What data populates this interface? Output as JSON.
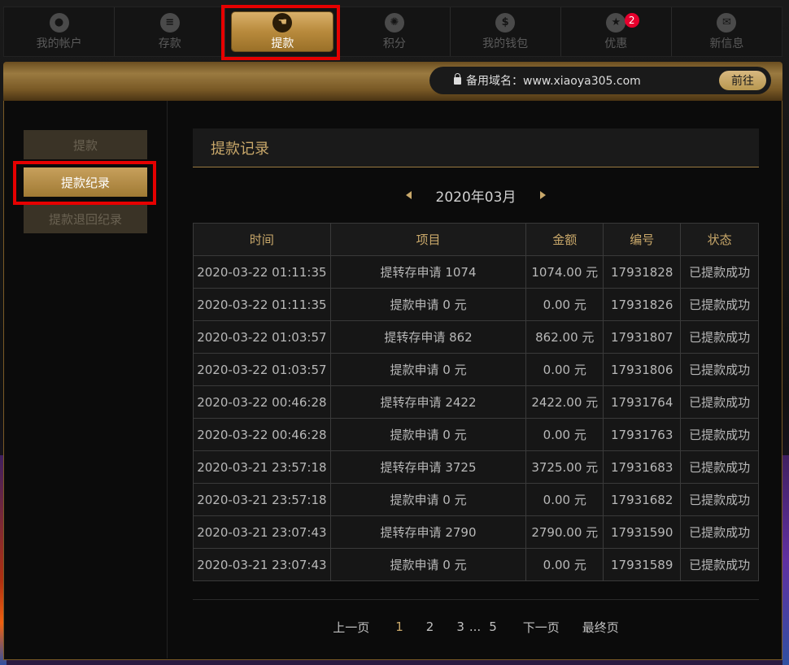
{
  "nav": {
    "items": [
      {
        "label": "我的帐户",
        "icon": "user-icon",
        "glyph": "●"
      },
      {
        "label": "存款",
        "icon": "coins-icon",
        "glyph": "≡"
      },
      {
        "label": "提款",
        "icon": "hand-withdraw-icon",
        "glyph": "☚"
      },
      {
        "label": "积分",
        "icon": "chip-icon",
        "glyph": "✺"
      },
      {
        "label": "我的钱包",
        "icon": "dollar-icon",
        "glyph": "$"
      },
      {
        "label": "优惠",
        "icon": "star-icon",
        "glyph": "★",
        "badge": "2"
      },
      {
        "label": "新信息",
        "icon": "mail-icon",
        "glyph": "✉"
      }
    ]
  },
  "domain": {
    "text": "备用域名：www.xiaoya305.com",
    "button": "前往"
  },
  "sidebar": {
    "items": [
      {
        "label": "提款"
      },
      {
        "label": "提款纪录"
      },
      {
        "label": "提款退回纪录"
      }
    ]
  },
  "records": {
    "title": "提款记录",
    "month": "2020年03月",
    "columns": [
      "时间",
      "项目",
      "金额",
      "编号",
      "状态"
    ],
    "rows": [
      [
        "2020-03-22 01:11:35",
        "提转存申请 1074",
        "1074.00 元",
        "17931828",
        "已提款成功"
      ],
      [
        "2020-03-22 01:11:35",
        "提款申请 0 元",
        "0.00 元",
        "17931826",
        "已提款成功"
      ],
      [
        "2020-03-22 01:03:57",
        "提转存申请 862",
        "862.00 元",
        "17931807",
        "已提款成功"
      ],
      [
        "2020-03-22 01:03:57",
        "提款申请 0 元",
        "0.00 元",
        "17931806",
        "已提款成功"
      ],
      [
        "2020-03-22 00:46:28",
        "提转存申请 2422",
        "2422.00 元",
        "17931764",
        "已提款成功"
      ],
      [
        "2020-03-22 00:46:28",
        "提款申请 0 元",
        "0.00 元",
        "17931763",
        "已提款成功"
      ],
      [
        "2020-03-21 23:57:18",
        "提转存申请 3725",
        "3725.00 元",
        "17931683",
        "已提款成功"
      ],
      [
        "2020-03-21 23:57:18",
        "提款申请 0 元",
        "0.00 元",
        "17931682",
        "已提款成功"
      ],
      [
        "2020-03-21 23:07:43",
        "提转存申请 2790",
        "2790.00 元",
        "17931590",
        "已提款成功"
      ],
      [
        "2020-03-21 23:07:43",
        "提款申请 0 元",
        "0.00 元",
        "17931589",
        "已提款成功"
      ]
    ]
  },
  "pager": {
    "prev": "上一页",
    "pages": [
      "1",
      "2",
      "3",
      "...",
      "5"
    ],
    "current": "1",
    "next": "下一页",
    "last": "最终页"
  }
}
